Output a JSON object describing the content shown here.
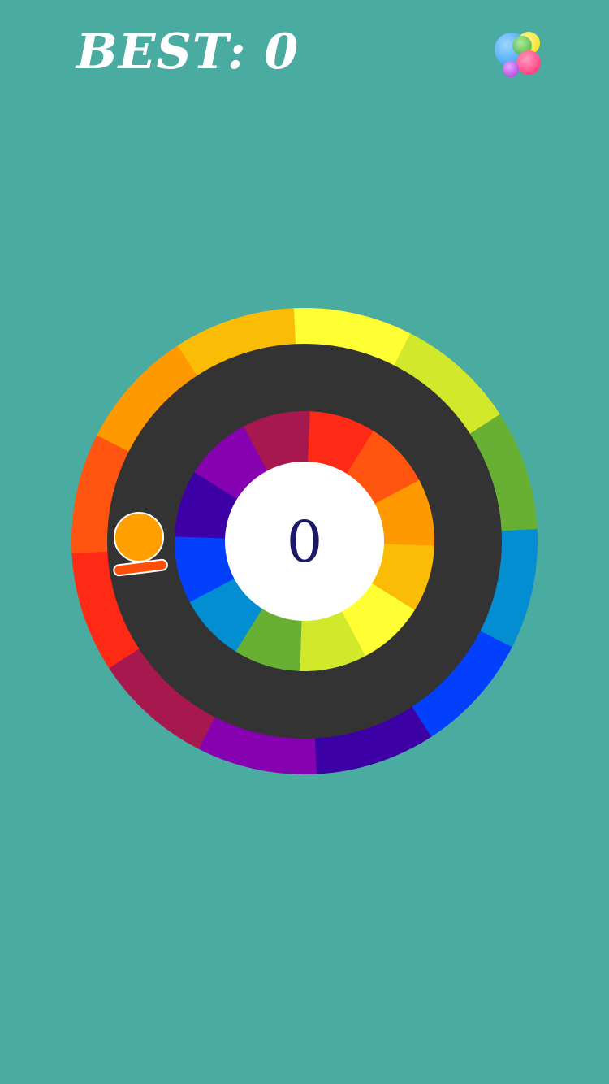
{
  "header": {
    "best_label": "BEST: 0"
  },
  "game_center": {
    "icon": "game-center-bubbles-icon",
    "bubble_colors": [
      "#3da1f5",
      "#f5e21c",
      "#48b848",
      "#ff3d7f",
      "#b44ae0"
    ]
  },
  "game": {
    "score": "0",
    "colors": {
      "background": "#4aaba0",
      "track": "#333333",
      "center": "#ffffff",
      "ball": "#ffa000",
      "paddle": "#ff4e0a"
    },
    "palette": [
      "#ff2a16",
      "#ff5510",
      "#ff9900",
      "#fbbc05",
      "#ffff33",
      "#d2e82a",
      "#67b033",
      "#028ed0",
      "#0340fe",
      "#3d00a4",
      "#8601af",
      "#a7184f"
    ],
    "outer_ring_order": [
      4,
      5,
      6,
      7,
      8,
      9,
      10,
      11,
      0,
      1,
      2,
      3
    ],
    "inner_ring_order": [
      0,
      1,
      2,
      3,
      4,
      5,
      6,
      7,
      8,
      9,
      10,
      11
    ]
  }
}
